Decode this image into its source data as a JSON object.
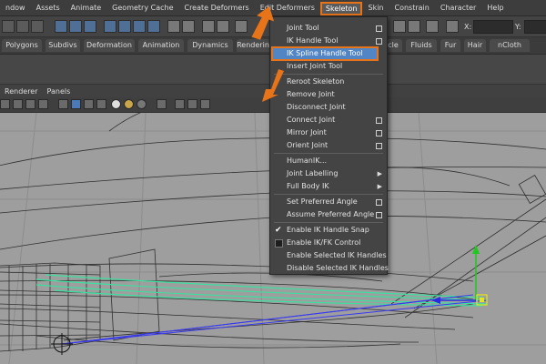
{
  "menubar": {
    "items": [
      "ndow",
      "Assets",
      "Animate",
      "Geometry Cache",
      "Create Deformers",
      "Edit Deformers",
      "Skeleton",
      "Skin",
      "Constrain",
      "Character",
      "Help"
    ],
    "active": "Skeleton"
  },
  "status_line": {
    "x_label": "X:",
    "y_label": "Y:"
  },
  "shelf": {
    "tabs": [
      "Polygons",
      "Subdivs",
      "Deformation",
      "Animation",
      "Dynamics",
      "Renderin",
      "cle",
      "Fluids",
      "Fur",
      "Hair",
      "nCloth"
    ]
  },
  "panel_menu": {
    "items": [
      "Renderer",
      "Panels"
    ]
  },
  "skeleton_menu": {
    "items": [
      {
        "label": "Joint Tool",
        "option": true
      },
      {
        "label": "IK Handle Tool",
        "option": true
      },
      {
        "label": "IK Spline Handle Tool",
        "option": true,
        "highlighted": true
      },
      {
        "label": "Insert Joint Tool",
        "option": false
      },
      {
        "label": "Reroot Skeleton",
        "option": false
      },
      {
        "label": "Remove Joint",
        "option": false
      },
      {
        "label": "Disconnect Joint",
        "option": false
      },
      {
        "label": "Connect Joint",
        "option": true
      },
      {
        "label": "Mirror Joint",
        "option": true
      },
      {
        "label": "Orient Joint",
        "option": true
      },
      {
        "label": "HumanIK...",
        "option": false
      },
      {
        "label": "Joint Labelling",
        "submenu": true
      },
      {
        "label": "Full Body IK",
        "submenu": true
      },
      {
        "label": "Set Preferred Angle",
        "option": true
      },
      {
        "label": "Assume Preferred Angle",
        "option": true
      },
      {
        "label": "Enable IK Handle Snap",
        "checked": true
      },
      {
        "label": "Enable IK/FK Control",
        "checkbox": true
      },
      {
        "label": "Enable Selected IK Handles"
      },
      {
        "label": "Disable Selected IK Handles"
      }
    ]
  },
  "colors": {
    "highlight": "#5285c4",
    "callout": "#e8741a",
    "wireframe": "#2e2e2e",
    "ik_curve": "#3be0a0",
    "ik_blue": "#3a3af0",
    "manip_green": "#1fc81f",
    "manip_yellow": "#e6e61a"
  }
}
